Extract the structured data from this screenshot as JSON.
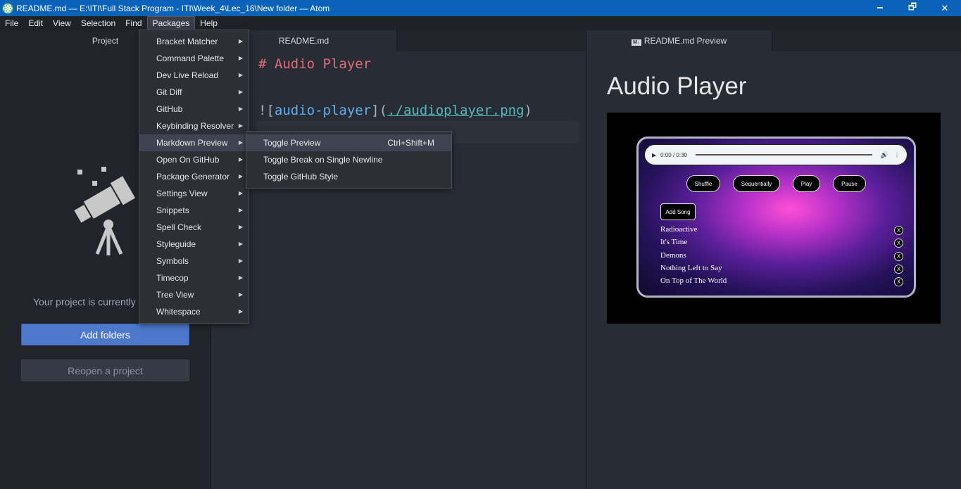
{
  "window": {
    "title": "README.md — E:\\ITI\\Full Stack Program - ITI\\Week_4\\Lec_16\\New folder — Atom",
    "minimize": "🗕",
    "maximize": "🗗",
    "close": "✕"
  },
  "menubar": [
    "File",
    "Edit",
    "View",
    "Selection",
    "Find",
    "Packages",
    "Help"
  ],
  "tree": {
    "tab_label": "Project",
    "empty_message": "Your project is currently empty",
    "add_folders": "Add folders",
    "reopen_project": "Reopen a project"
  },
  "editor": {
    "tab_label": "README.md",
    "line1": "# Audio Player",
    "line3": {
      "bang_open": "![",
      "alt": "audio-player",
      "mid": "](",
      "url": "./audioplayer.png",
      "close": ")"
    }
  },
  "preview": {
    "tab_label": "README.md Preview",
    "badge": "M↓",
    "heading": "Audio Player",
    "image": {
      "player_time": "0:00 / 0:30",
      "buttons": [
        "Shuffle",
        "Sequentially",
        "Play",
        "Pause"
      ],
      "add_song": "Add Song",
      "songs": [
        "Radioactive",
        "It's Time",
        "Demons",
        "Nothing Left to Say",
        "On Top of The World"
      ],
      "remove_label": "X"
    }
  },
  "packages_menu": {
    "items": [
      "Bracket Matcher",
      "Command Palette",
      "Dev Live Reload",
      "Git Diff",
      "GitHub",
      "Keybinding Resolver",
      "Markdown Preview",
      "Open On GitHub",
      "Package Generator",
      "Settings View",
      "Snippets",
      "Spell Check",
      "Styleguide",
      "Symbols",
      "Timecop",
      "Tree View",
      "Whitespace"
    ],
    "highlighted": "Markdown Preview"
  },
  "markdown_submenu": {
    "items": [
      {
        "label": "Toggle Preview",
        "accel": "Ctrl+Shift+M"
      },
      {
        "label": "Toggle Break on Single Newline",
        "accel": ""
      },
      {
        "label": "Toggle GitHub Style",
        "accel": ""
      }
    ],
    "highlighted": "Toggle Preview"
  },
  "colors": {
    "titlebar": "#0a63b8",
    "accent_button": "#4d78cc",
    "heading_markdown": "#e06c75",
    "link_alt": "#61afef",
    "link_url": "#56b6c2"
  }
}
